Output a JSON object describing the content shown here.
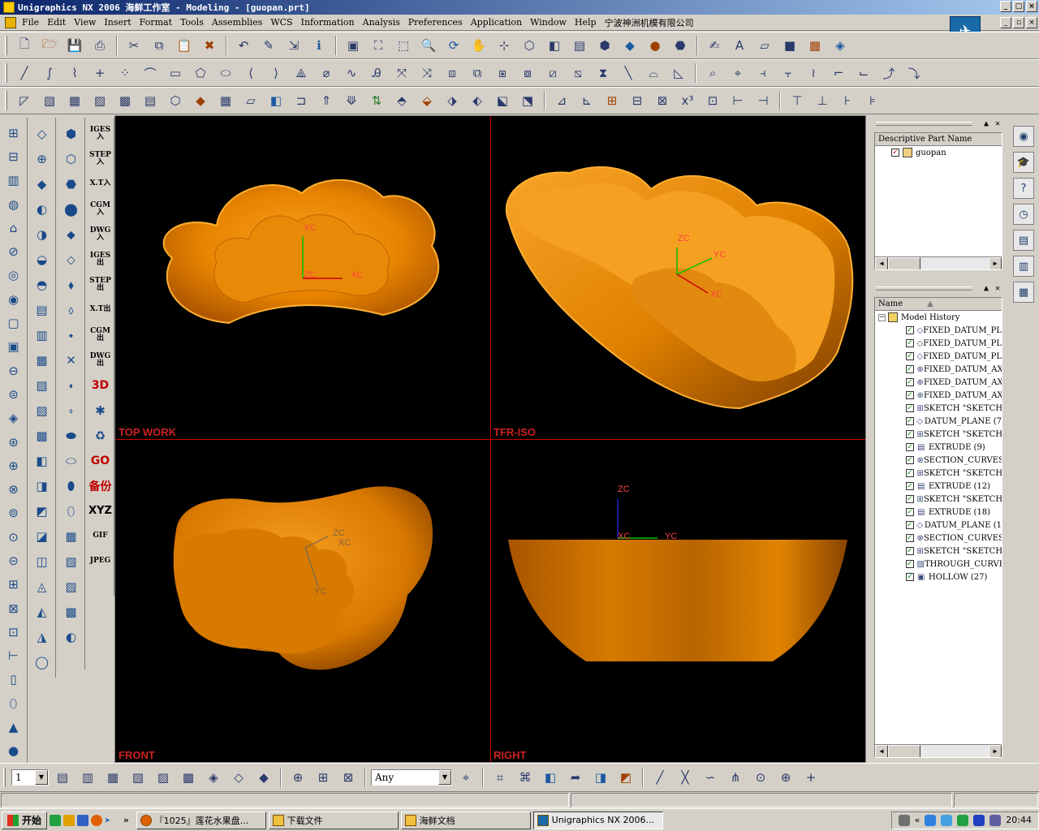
{
  "window": {
    "title": "Unigraphics NX 2006 海鲜工作室 - Modeling - [guopan.prt]"
  },
  "menu": {
    "items": [
      "File",
      "Edit",
      "View",
      "Insert",
      "Format",
      "Tools",
      "Assemblies",
      "WCS",
      "Information",
      "Analysis",
      "Preferences",
      "Application",
      "Window",
      "Help",
      "宁波神洲机模有限公司"
    ]
  },
  "left_text_tools": {
    "iges_in": "IGES入",
    "step_in": "STEP入",
    "xt_in": "X.T入",
    "cgm_in": "CGM入",
    "dwg_in": "DWG入",
    "iges_out": "IGES出",
    "step_out": "STEP出",
    "xt_out": "X.T出",
    "cgm_out": "CGM出",
    "dwg_out": "DWG出",
    "3d": "3D",
    "go": "GO",
    "backup": "备份",
    "xyz": "XYZ",
    "gif": "GIF",
    "jpeg": "JPEG"
  },
  "viewports": {
    "top_left": "TOP WORK",
    "top_right": "TFR-ISO",
    "bottom_left": "FRONT",
    "bottom_right": "RIGHT"
  },
  "axes": {
    "xc": "XC",
    "yc": "YC",
    "zc": "ZC"
  },
  "part_navigator": {
    "column": "Descriptive Part Name",
    "part": "guopan"
  },
  "model_navigator": {
    "column": "Name",
    "root": "Model History",
    "features": [
      "FIXED_DATUM_PL",
      "FIXED_DATUM_PL",
      "FIXED_DATUM_PL",
      "FIXED_DATUM_AX",
      "FIXED_DATUM_AX",
      "FIXED_DATUM_AX",
      "SKETCH \"SKETCH",
      "DATUM_PLANE (7",
      "SKETCH \"SKETCH",
      "EXTRUDE (9)",
      "SECTION_CURVES",
      "SKETCH \"SKETCH",
      "EXTRUDE (12)",
      "SKETCH \"SKETCH",
      "EXTRUDE (18)",
      "DATUM_PLANE (1",
      "SECTION_CURVES",
      "SKETCH \"SKETCH",
      "THROUGH_CURVE_",
      "HOLLOW (27)"
    ]
  },
  "bottom_toolbar": {
    "layer_value": "1",
    "filter_value": "Any"
  },
  "taskbar": {
    "start": "开始",
    "tasks": [
      "『1025』莲花水果盘...",
      "下载文件",
      "海鲜文档",
      "Unigraphics NX 2006..."
    ],
    "clock": "20:44"
  },
  "colors": {
    "part_orange": "#f28c00",
    "viewport_border": "#cc0000",
    "title_gradient_start": "#0a246a"
  }
}
